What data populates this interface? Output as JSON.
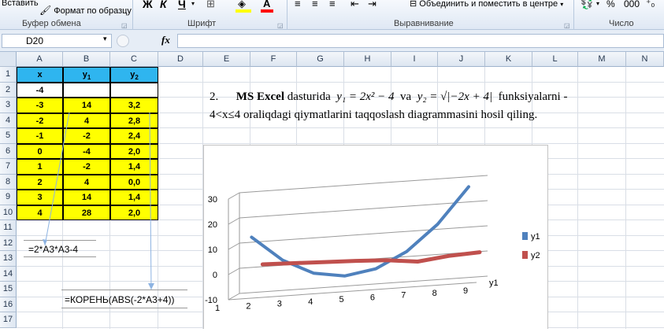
{
  "ribbon": {
    "paste_label": "Вставить",
    "format_painter_label": "Формат по образцу",
    "clipboard_group": "Буфер обмена",
    "font_group": "Шрифт",
    "align_group": "Выравнивание",
    "number_group": "Число",
    "bold": "Ж",
    "italic": "К",
    "underline": "Ч",
    "merge_label": "Объединить и поместить в центре",
    "percent": "%",
    "thousands": "000",
    "colors": {
      "fill": "#ffff00",
      "font": "#ff0000"
    }
  },
  "formula_bar": {
    "name_box": "D20",
    "fx": "fx",
    "formula": ""
  },
  "columns": [
    "A",
    "B",
    "C",
    "D",
    "E",
    "F",
    "G",
    "H",
    "I",
    "J",
    "K",
    "L",
    "M",
    "N"
  ],
  "rows": [
    "1",
    "2",
    "3",
    "4",
    "5",
    "6",
    "7",
    "8",
    "9",
    "10",
    "11",
    "12",
    "13",
    "14",
    "15",
    "16",
    "17"
  ],
  "table": {
    "headers": [
      "x",
      "y",
      "y"
    ],
    "header_subs": [
      "",
      "1",
      "2"
    ],
    "row2": [
      "-4",
      "",
      ""
    ],
    "data": [
      [
        "-3",
        "14",
        "3,2"
      ],
      [
        "-2",
        "4",
        "2,8"
      ],
      [
        "-1",
        "-2",
        "2,4"
      ],
      [
        "0",
        "-4",
        "2,0"
      ],
      [
        "1",
        "-2",
        "1,4"
      ],
      [
        "2",
        "4",
        "0,0"
      ],
      [
        "3",
        "14",
        "1,4"
      ],
      [
        "4",
        "28",
        "2,0"
      ]
    ]
  },
  "formulas": {
    "f1": "=2*A3*A3-4",
    "f2": "=КОРЕНЬ(ABS(-2*A3+4))"
  },
  "task": {
    "line1_num": "2.",
    "line1_a": "MS Excel",
    "line1_b": "dasturida",
    "eq1": "y₁ = 2x² − 4",
    "va": "va",
    "eq2": "y₂ = √|−2x + 4|",
    "line1_c": "funksiyalarni -",
    "line2": "4<x≤4 oraliqdagi qiymatlarini taqqoslash diagrammasini hosil qiling."
  },
  "chart_data": {
    "type": "line",
    "title": "",
    "categories": [
      "1",
      "2",
      "3",
      "4",
      "5",
      "6",
      "7",
      "8",
      "9"
    ],
    "y_ticks": [
      "30",
      "20",
      "10",
      "0",
      "-10"
    ],
    "ylim": [
      -10,
      30
    ],
    "depth_label": "y1",
    "legend_position": "right",
    "series": [
      {
        "name": "y1",
        "color": "#4f81bd",
        "values": [
          null,
          14,
          4,
          -2,
          -4,
          -2,
          4,
          14,
          28
        ]
      },
      {
        "name": "y2",
        "color": "#c0504d",
        "values": [
          null,
          3.2,
          2.8,
          2.4,
          2.0,
          1.4,
          0.0,
          1.4,
          2.0
        ]
      }
    ]
  }
}
